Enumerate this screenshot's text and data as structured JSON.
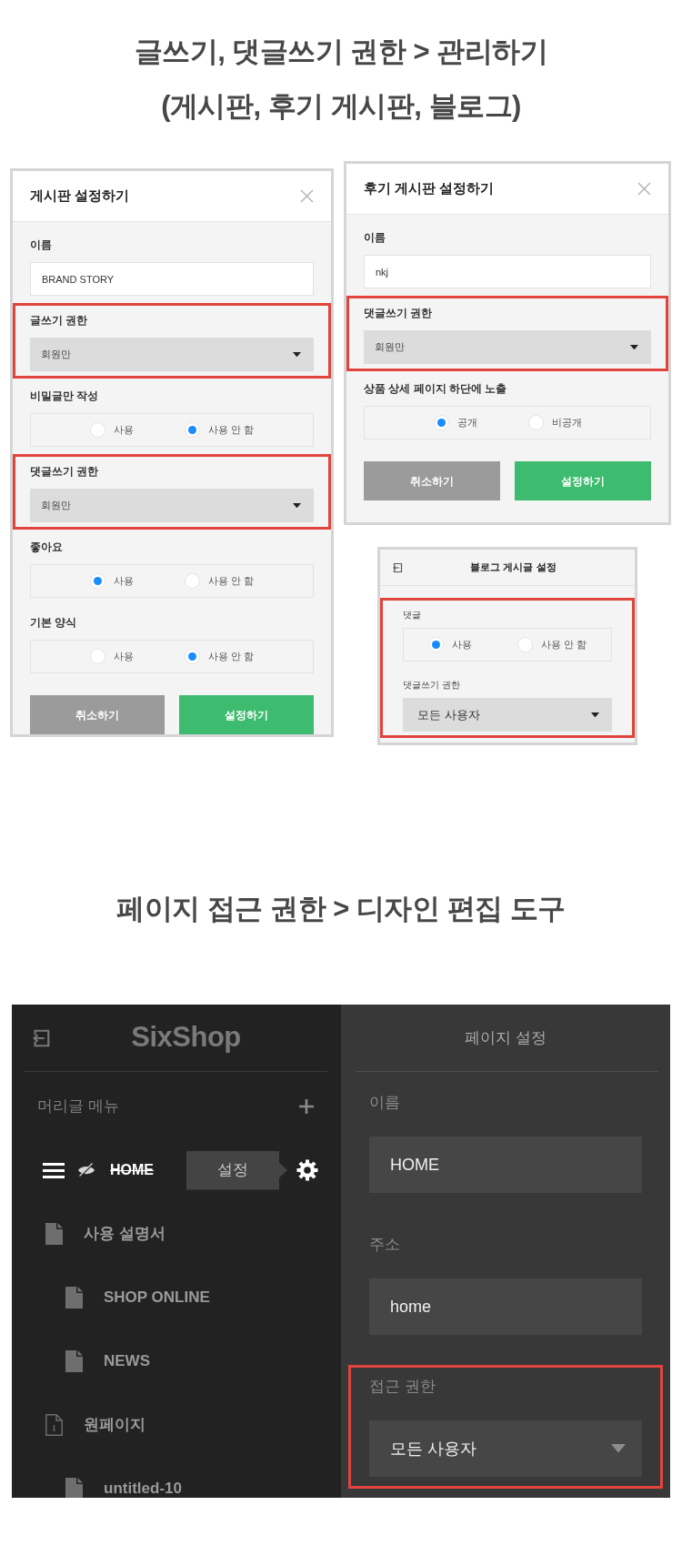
{
  "section_1": {
    "title_lines": [
      "글쓰기, 댓글쓰기 권한 > 관리하기",
      "(게시판, 후기 게시판, 블로그)"
    ],
    "dialogs": [
      {
        "kind": "modal",
        "title": "게시판 설정하기",
        "fields": [
          {
            "kind": "text",
            "label": "이름",
            "value": "BRAND STORY",
            "highlighted": false
          },
          {
            "kind": "select",
            "label": "글쓰기 권한",
            "value": "회원만",
            "highlighted": true
          },
          {
            "kind": "radio",
            "label": "비밀글만 작성",
            "options": [
              {
                "label": "사용",
                "selected": false
              },
              {
                "label": "사용 안 함",
                "selected": true
              }
            ],
            "highlighted": false
          },
          {
            "kind": "select",
            "label": "댓글쓰기 권한",
            "value": "회원만",
            "highlighted": true
          },
          {
            "kind": "radio",
            "label": "좋아요",
            "options": [
              {
                "label": "사용",
                "selected": true
              },
              {
                "label": "사용 안 함",
                "selected": false
              }
            ],
            "highlighted": false
          },
          {
            "kind": "radio",
            "label": "기본 양식",
            "options": [
              {
                "label": "사용",
                "selected": false
              },
              {
                "label": "사용 안 함",
                "selected": true
              }
            ],
            "highlighted": false
          }
        ],
        "buttons": [
          {
            "kind": "cancel",
            "label": "취소하기"
          },
          {
            "kind": "confirm",
            "label": "설정하기"
          }
        ]
      },
      {
        "kind": "modal",
        "title": "후기 게시판 설정하기",
        "fields": [
          {
            "kind": "text",
            "label": "이름",
            "value": "nkj",
            "highlighted": false
          },
          {
            "kind": "select",
            "label": "댓글쓰기 권한",
            "value": "회원만",
            "highlighted": true
          },
          {
            "kind": "radio",
            "label": "상품 상세 페이지 하단에 노출",
            "options": [
              {
                "label": "공개",
                "selected": true
              },
              {
                "label": "비공개",
                "selected": false
              }
            ],
            "highlighted": false
          }
        ],
        "buttons": [
          {
            "kind": "cancel",
            "label": "취소하기"
          },
          {
            "kind": "confirm",
            "label": "설정하기"
          }
        ]
      },
      {
        "kind": "panel",
        "title": "블로그 게시글 설정",
        "fields": [
          {
            "kind": "radio",
            "label": "댓글",
            "options": [
              {
                "label": "사용",
                "selected": true
              },
              {
                "label": "사용 안 함",
                "selected": false
              }
            ],
            "highlighted": true
          },
          {
            "kind": "select",
            "label": "댓글쓰기 권한",
            "value": "모든 사용자",
            "highlighted": true
          }
        ]
      }
    ]
  },
  "section_2": {
    "title": "페이지 접근 권한 > 디자인 편집 도구",
    "editor": {
      "sidebar": {
        "logo": "SixShop",
        "menu_title": "머리글 메뉴",
        "items": [
          {
            "label": "HOME",
            "selected": true,
            "hidden": true,
            "tooltip": "설정"
          },
          {
            "kind": "page",
            "label": "사용 설명서",
            "selected": false,
            "hidden": false,
            "children": [
              {
                "kind": "page",
                "label": "SHOP ONLINE",
                "selected": false,
                "hidden": false
              },
              {
                "kind": "page",
                "label": "NEWS",
                "selected": false,
                "hidden": false
              }
            ]
          },
          {
            "kind": "onepage",
            "label": "원페이지",
            "selected": false,
            "hidden": false,
            "children": [
              {
                "kind": "page",
                "label": "untitled-10",
                "selected": false,
                "hidden": false
              }
            ]
          }
        ]
      },
      "settings": {
        "title": "페이지 설정",
        "fields": [
          {
            "kind": "text",
            "label": "이름",
            "value": "HOME",
            "highlighted": false
          },
          {
            "kind": "text",
            "label": "주소",
            "value": "home",
            "highlighted": false
          },
          {
            "kind": "select",
            "label": "접근 권한",
            "value": "모든 사용자",
            "highlighted": true
          }
        ]
      }
    }
  }
}
